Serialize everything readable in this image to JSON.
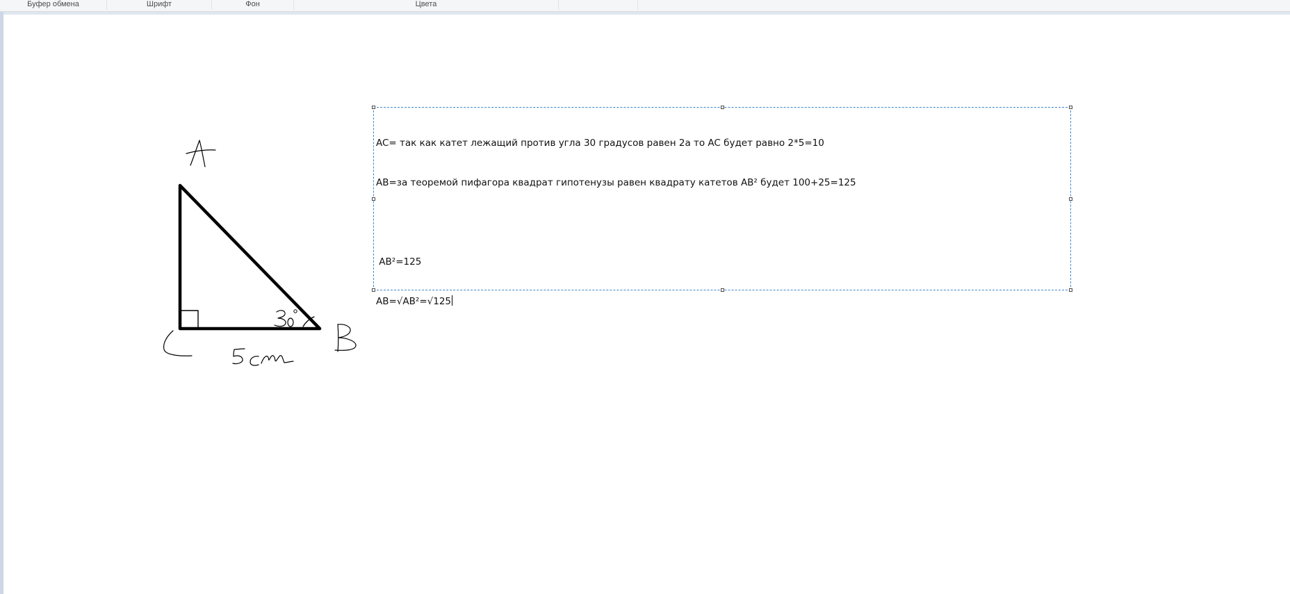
{
  "ribbon": {
    "groups": {
      "clipboard": "Буфер обмена",
      "font": "Шрифт",
      "background": "Фон",
      "colors": "Цвета"
    }
  },
  "canvas": {
    "sketch": {
      "vertex_a": "A",
      "vertex_b": "B",
      "vertex_c": "C",
      "angle": "30°",
      "side_cb": "5 см"
    },
    "textbox": {
      "line1": "AC= так как катет лежащий против угла 30 градусов равен 2а то AC будет равно 2*5=10",
      "line2": "AB=за теоремой пифагора квадрат гипотенузы равен квадрату катетов AB² будет 100+25=125",
      "line3": "",
      "line4": " AB²=125",
      "line5": "AB=√AB²=√125"
    }
  },
  "colors": {
    "workspace": "#cdd7e5",
    "selection": "#3f86c9",
    "ink": "#000000"
  }
}
